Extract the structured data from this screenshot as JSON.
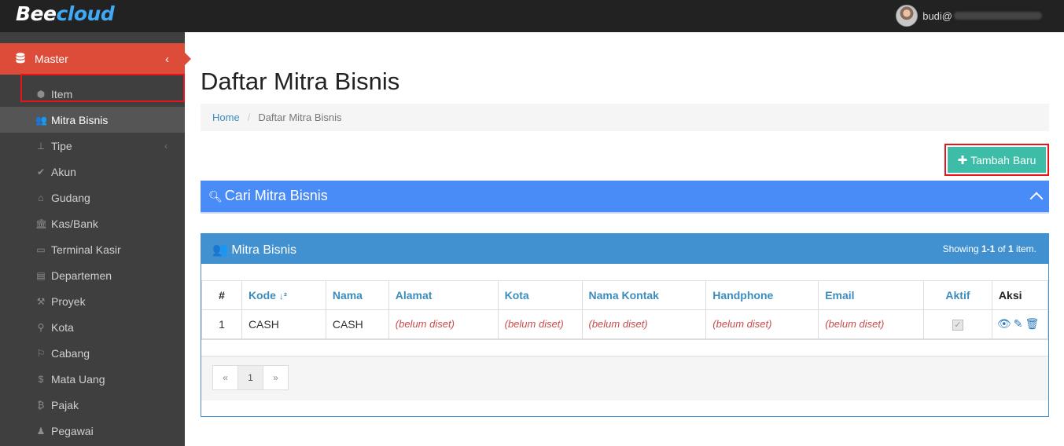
{
  "brand": {
    "part1": "Bee",
    "part2": "cloud"
  },
  "user": {
    "name": "budi@"
  },
  "sidebar": {
    "section": {
      "label": "Master",
      "icon": "database-icon"
    },
    "items": [
      {
        "label": "Item",
        "icon": "cube-icon"
      },
      {
        "label": "Mitra Bisnis",
        "icon": "users-icon",
        "active": true
      },
      {
        "label": "Tipe",
        "icon": "sitemap-icon",
        "has_children": true
      },
      {
        "label": "Akun",
        "icon": "check-icon"
      },
      {
        "label": "Gudang",
        "icon": "home-icon"
      },
      {
        "label": "Kas/Bank",
        "icon": "bank-icon"
      },
      {
        "label": "Terminal Kasir",
        "icon": "monitor-icon"
      },
      {
        "label": "Departemen",
        "icon": "clipboard-icon"
      },
      {
        "label": "Proyek",
        "icon": "hammer-icon"
      },
      {
        "label": "Kota",
        "icon": "map-marker-icon"
      },
      {
        "label": "Cabang",
        "icon": "flag-icon"
      },
      {
        "label": "Mata Uang",
        "icon": "dollar-icon"
      },
      {
        "label": "Pajak",
        "icon": "bitcoin-icon"
      },
      {
        "label": "Pegawai",
        "icon": "person-icon"
      }
    ]
  },
  "page": {
    "title": "Daftar Mitra Bisnis",
    "breadcrumb": {
      "home": "Home",
      "current": "Daftar Mitra Bisnis"
    },
    "add_button": "Tambah Baru"
  },
  "search_panel": {
    "title": "Cari Mitra Bisnis"
  },
  "grid": {
    "title": "Mitra Bisnis",
    "summary": {
      "prefix": "Showing ",
      "range": "1-1",
      "mid": " of ",
      "total": "1",
      "suffix": " item."
    },
    "columns": [
      "#",
      "Kode",
      "Nama",
      "Alamat",
      "Kota",
      "Nama Kontak",
      "Handphone",
      "Email",
      "Aktif",
      "Aksi"
    ],
    "rows": [
      {
        "no": "1",
        "kode": "CASH",
        "nama": "CASH",
        "alamat": "(belum diset)",
        "kota": "(belum diset)",
        "nama_kontak": "(belum diset)",
        "handphone": "(belum diset)",
        "email": "(belum diset)",
        "aktif": true
      }
    ],
    "pager": {
      "prev": "«",
      "page": "1",
      "next": "»"
    }
  }
}
